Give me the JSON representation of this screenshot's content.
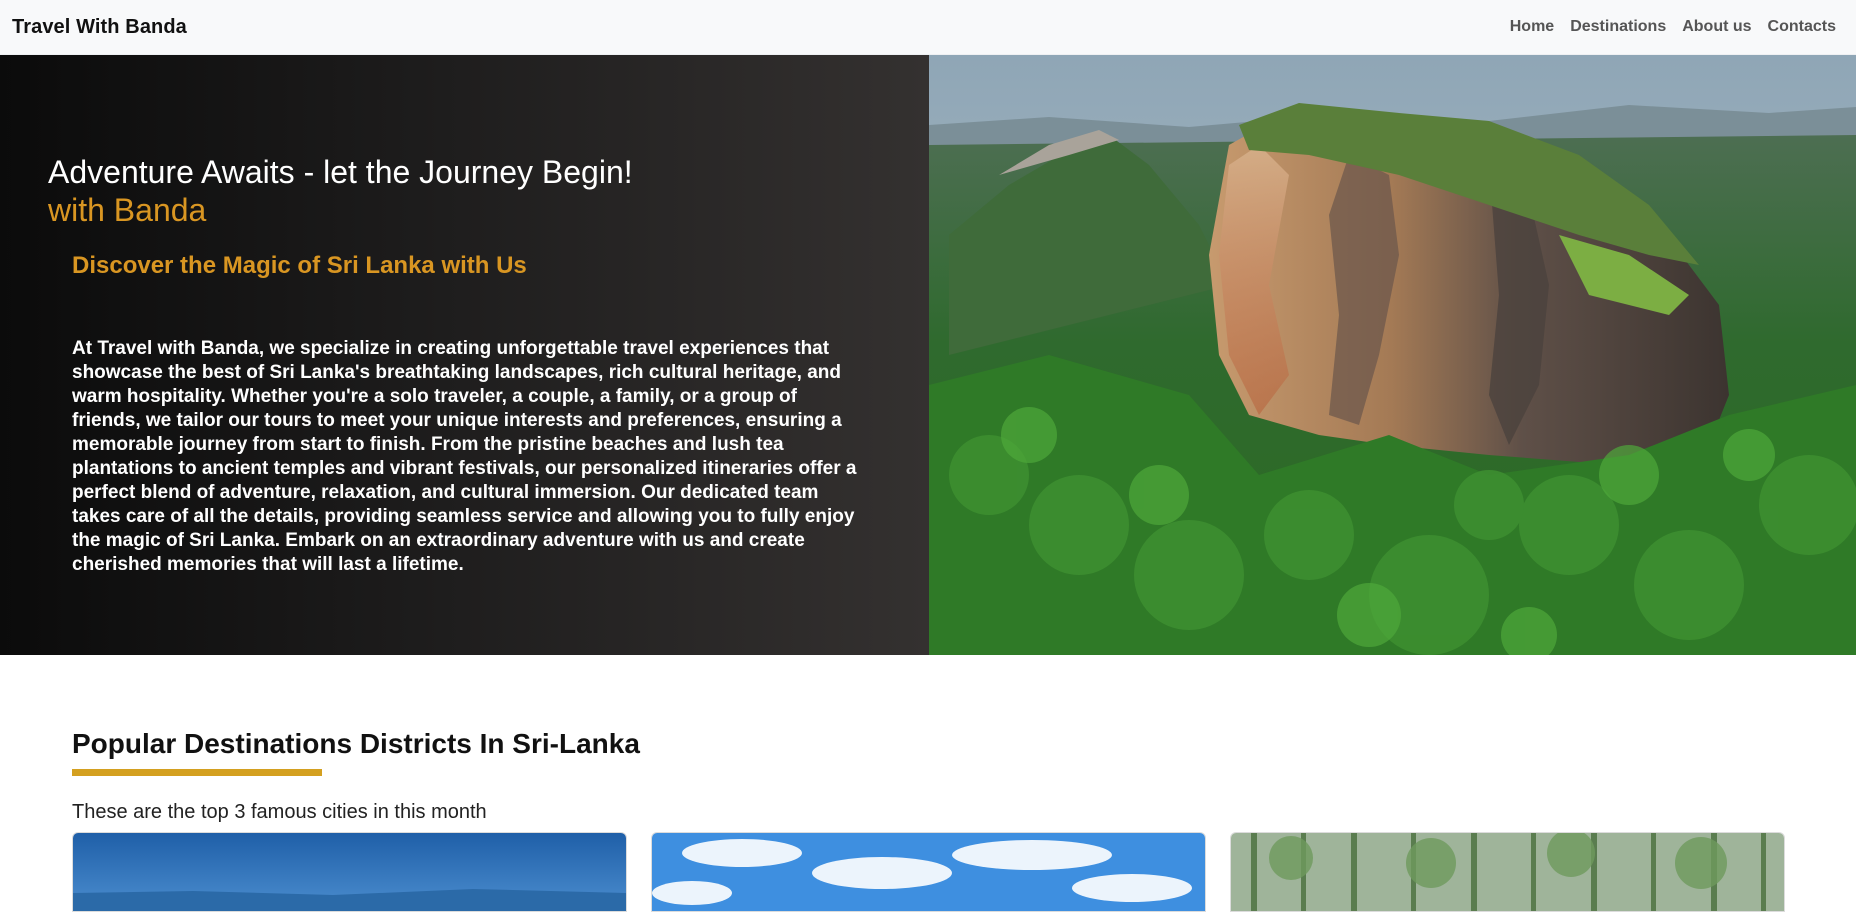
{
  "navbar": {
    "brand": "Travel With Banda",
    "links": [
      "Home",
      "Destinations",
      "About us",
      "Contacts"
    ]
  },
  "hero": {
    "title": "Adventure Awaits - let the Journey Begin!",
    "subtitle": "with Banda",
    "tagline": "Discover the Magic of Sri Lanka with Us",
    "description": "At Travel with Banda, we specialize in creating unforgettable travel experiences that showcase the best of Sri Lanka's breathtaking landscapes, rich cultural heritage, and warm hospitality. Whether you're a solo traveler, a couple, a family, or a group of friends, we tailor our tours to meet your unique interests and preferences, ensuring a memorable journey from start to finish. From the pristine beaches and lush tea plantations to ancient temples and vibrant festivals, our personalized itineraries offer a perfect blend of adventure, relaxation, and cultural immersion. Our dedicated team takes care of all the details, providing seamless service and allowing you to fully enjoy the magic of Sri Lanka. Embark on an extraordinary adventure with us and create cherished memories that will last a lifetime."
  },
  "destinations": {
    "title": "Popular Destinations Districts In Sri-Lanka",
    "description": "These are the top 3 famous cities in this month"
  },
  "colors": {
    "accent": "#d99622",
    "underline": "#d4a020",
    "navbar_bg": "#f8f9fa"
  }
}
